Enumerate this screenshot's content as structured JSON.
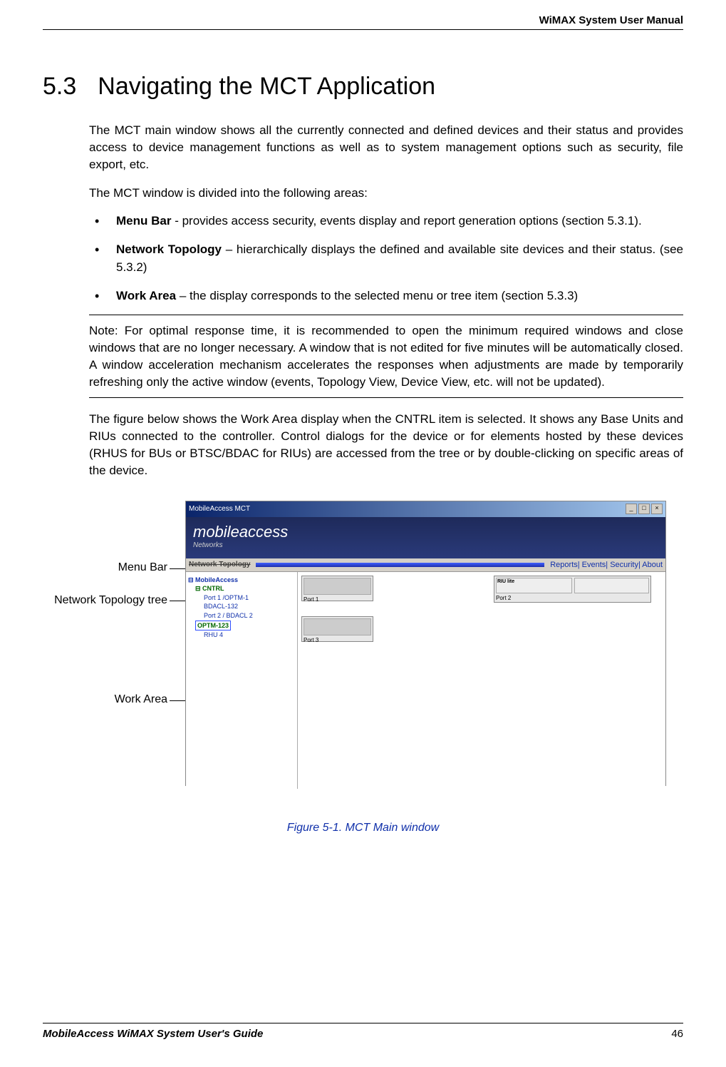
{
  "header_right": "WiMAX System User Manual",
  "section_number": "5.3",
  "section_title": "Navigating the MCT Application",
  "para1": "The MCT main window shows all the currently connected and defined devices and their status and provides access to device management functions as well as to system management options such as security, file export, etc.",
  "para2": "The MCT window is divided into the following areas:",
  "bullet1_bold": "Menu Bar",
  "bullet1_rest": " - provides access security, events display and report generation options (section 5.3.1).",
  "bullet2_bold": "Network Topology",
  "bullet2_rest": " – hierarchically displays the defined and available site devices and their status. (see 5.3.2)",
  "bullet3_bold": "Work Area",
  "bullet3_rest": " – the display corresponds to the selected menu or tree item (section 5.3.3)",
  "note": "Note: For optimal response time, it is recommended to open the minimum required windows and close windows that are no longer necessary.  A window that is not edited for five minutes will be automatically closed. A window acceleration mechanism accelerates the responses when adjustments are made by temporarily refreshing only the active window (events, Topology View, Device View, etc. will not be updated).",
  "para3": "The figure below shows the Work Area display when the CNTRL item is selected. It shows any Base Units and RIUs connected to the controller. Control dialogs for the device or for elements hosted by these devices (RHUS for BUs or BTSC/BDAC for RIUs) are accessed from the tree or by double-clicking on specific areas of the device.",
  "callout_menu": "Menu Bar",
  "callout_tree": "Network Topology tree",
  "callout_work": "Work Area",
  "screenshot": {
    "title": "MobileAccess MCT",
    "logo_main": "mobileaccess",
    "logo_net": "Networks",
    "menubar_left": "Network Topology",
    "menubar_right": "Reports| Events| Security| About",
    "tree_root": "⊟ MobileAccess",
    "tree_cntrl": "⊟ CNTRL",
    "tree_p1": "Port 1 /OPTM-1",
    "tree_p2": "BDACL-132",
    "tree_p3": "Port 2 / BDACL 2",
    "tree_optm": "OPTM-123",
    "tree_rhu": "RHU 4",
    "port1": "Port 1",
    "port2": "Port 2",
    "port3": "Port 3",
    "riu": "RIU lite"
  },
  "figure_caption": "Figure 5-1. MCT Main window",
  "footer_left": "MobileAccess WiMAX System User's Guide",
  "footer_right": "46"
}
